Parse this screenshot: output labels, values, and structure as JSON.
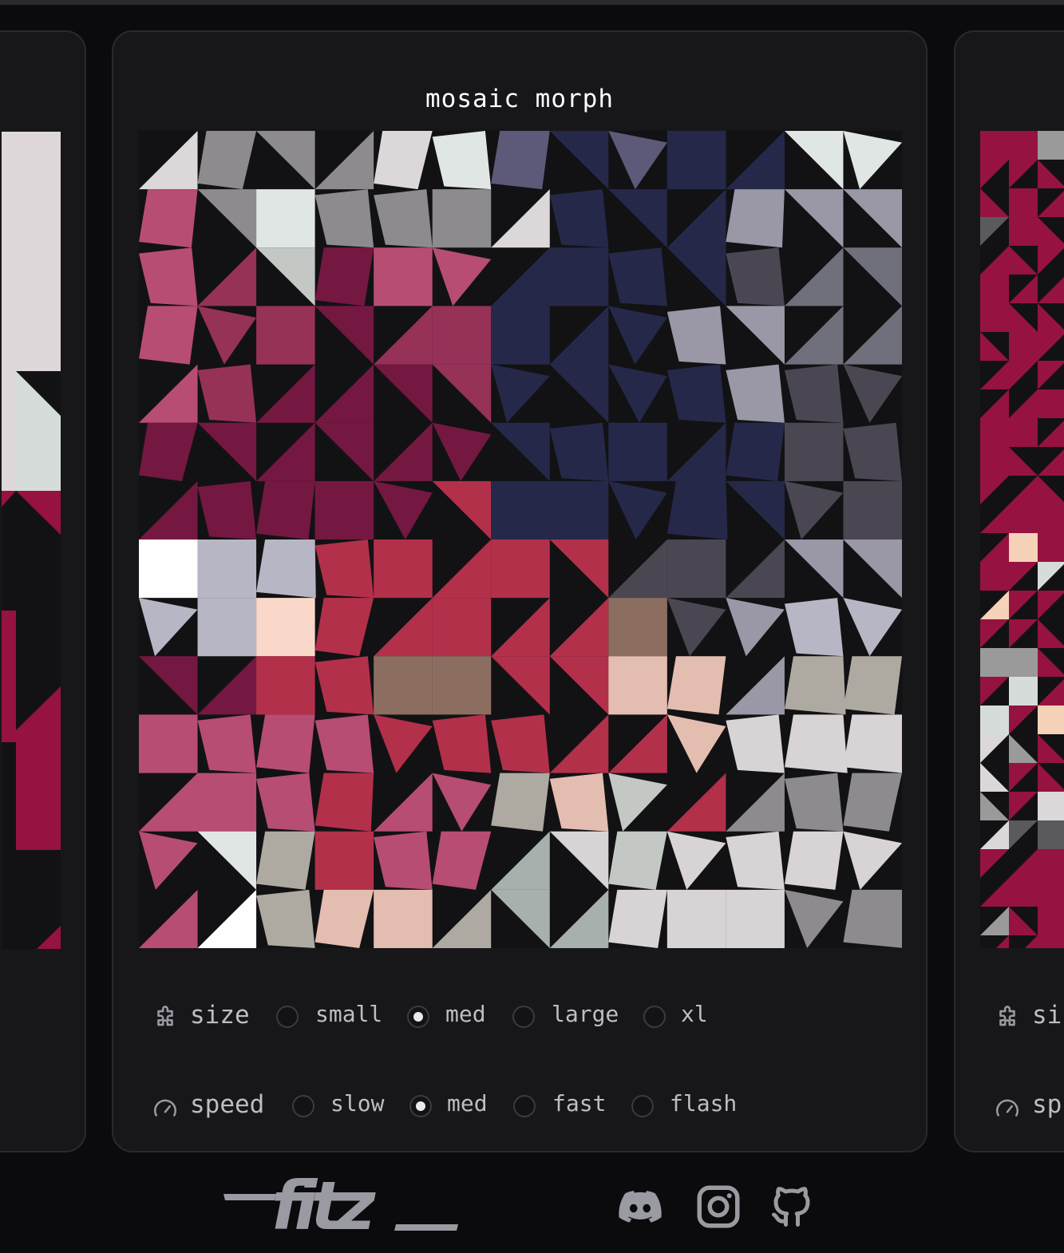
{
  "main": {
    "title": "mosaic morph",
    "size": {
      "label": "size",
      "icon": "puzzle-icon",
      "options": [
        "small",
        "med",
        "large",
        "xl"
      ],
      "selected": "med"
    },
    "speed": {
      "label": "speed",
      "icon": "gauge-icon",
      "options": [
        "slow",
        "med",
        "fast",
        "flash"
      ],
      "selected": "med"
    }
  },
  "right_card": {
    "size_label_partial": "si",
    "speed_label_partial": "sp"
  },
  "footer": {
    "logo_text": "fitz",
    "links": [
      "discord-icon",
      "instagram-icon",
      "github-icon"
    ]
  },
  "colors": {
    "background": "#0b0b0d",
    "card": "#17171a",
    "card_border": "#2a2a2e",
    "crimson": "#961240",
    "navy": "#26284a",
    "maroon": "#741841",
    "red": "#b3304a",
    "pink": "#b74d72",
    "muted_text": "#bdbdc4",
    "icon_gray": "#9a9aa2"
  }
}
